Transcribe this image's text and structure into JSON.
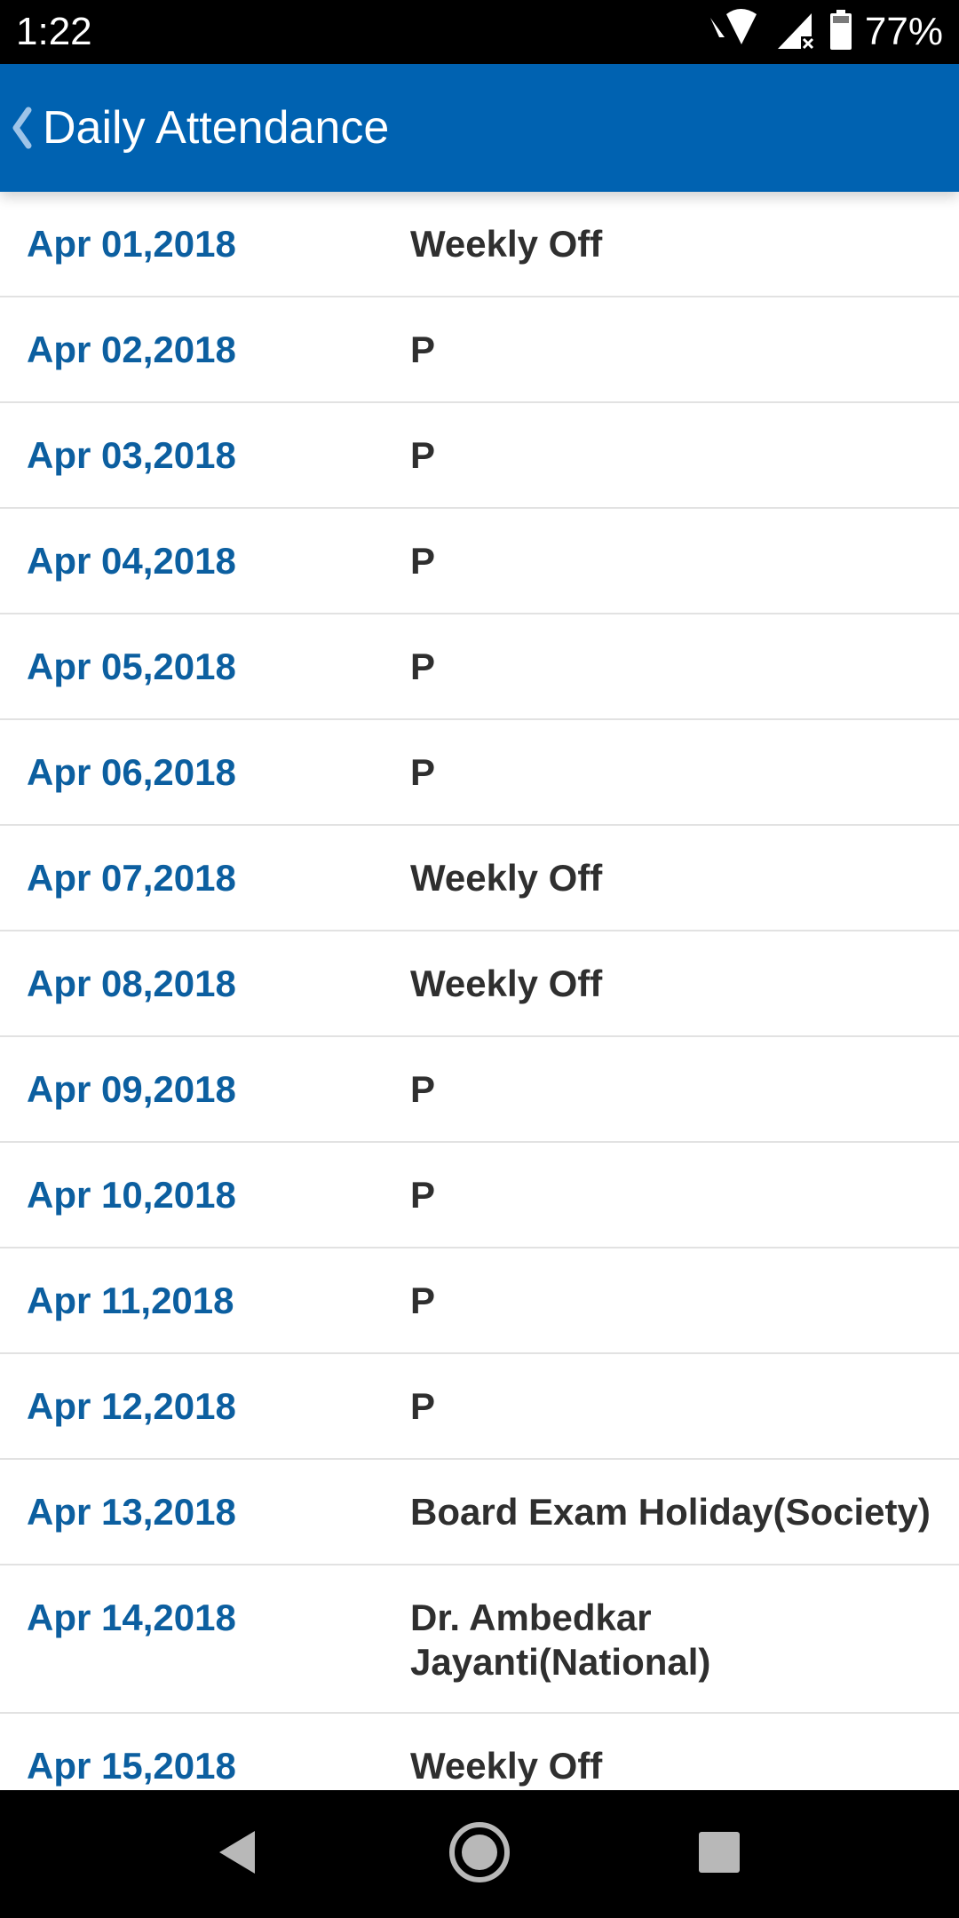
{
  "status_bar": {
    "time": "1:22",
    "battery_percent": "77%",
    "icons": [
      "wifi-icon",
      "cell-signal-icon",
      "battery-icon"
    ]
  },
  "header": {
    "title": "Daily Attendance",
    "back_icon": "chevron-left-icon",
    "background_color": "#0062B1"
  },
  "colors": {
    "date_text": "#0C5FA0",
    "status_text": "#2f2f2f",
    "divider": "#e2e2e2"
  },
  "attendance": [
    {
      "date": "Apr 01,2018",
      "status": "Weekly Off"
    },
    {
      "date": "Apr 02,2018",
      "status": "P"
    },
    {
      "date": "Apr 03,2018",
      "status": "P"
    },
    {
      "date": "Apr 04,2018",
      "status": "P"
    },
    {
      "date": "Apr 05,2018",
      "status": "P"
    },
    {
      "date": "Apr 06,2018",
      "status": "P"
    },
    {
      "date": "Apr 07,2018",
      "status": "Weekly Off"
    },
    {
      "date": "Apr 08,2018",
      "status": "Weekly Off"
    },
    {
      "date": "Apr 09,2018",
      "status": "P"
    },
    {
      "date": "Apr 10,2018",
      "status": "P"
    },
    {
      "date": "Apr 11,2018",
      "status": "P"
    },
    {
      "date": "Apr 12,2018",
      "status": "P"
    },
    {
      "date": "Apr 13,2018",
      "status": "Board Exam Holiday(Society)"
    },
    {
      "date": "Apr 14,2018",
      "status": "Dr. Ambedkar Jayanti(National)"
    },
    {
      "date": "Apr 15,2018",
      "status": "Weekly Off"
    }
  ],
  "nav_bar": {
    "buttons": [
      "back-triangle-icon",
      "home-circle-icon",
      "recents-square-icon"
    ]
  }
}
